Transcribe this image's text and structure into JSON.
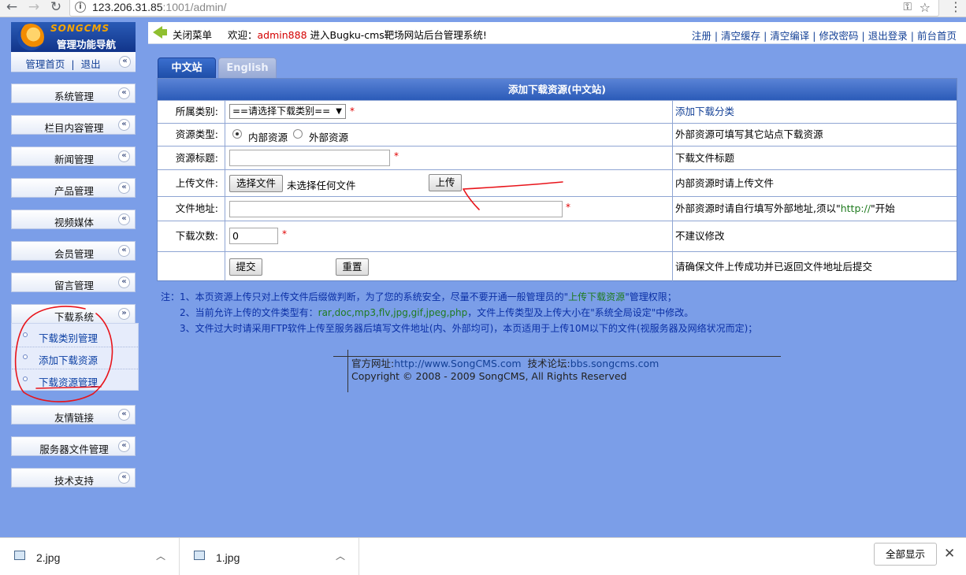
{
  "browser": {
    "url_host": "123.206.31.85",
    "url_path": ":1001/admin/"
  },
  "leftnav": {
    "brand": "SONGCMS",
    "title": "管理功能导航",
    "home": "管理首页",
    "sep": "|",
    "logout": "退出",
    "items": [
      {
        "label": "系统管理"
      },
      {
        "label": "栏目内容管理"
      },
      {
        "label": "新闻管理"
      },
      {
        "label": "产品管理"
      },
      {
        "label": "视频媒体"
      },
      {
        "label": "会员管理"
      },
      {
        "label": "留言管理"
      },
      {
        "label": "下载系统"
      },
      {
        "label": "友情链接"
      },
      {
        "label": "服务器文件管理"
      },
      {
        "label": "技术支持"
      }
    ],
    "submenu": [
      {
        "label": "下载类别管理"
      },
      {
        "label": "添加下载资源"
      },
      {
        "label": "下载资源管理"
      }
    ]
  },
  "topbar": {
    "close_menu": "关闭菜单",
    "welcome_prefix": "欢迎：",
    "username": "admin888",
    "welcome_suffix": "进入Bugku-cms靶场网站后台管理系统!",
    "links": [
      "注册",
      "清空缓存",
      "清空编译",
      "修改密码",
      "退出登录",
      "前台首页"
    ],
    "sep": "|"
  },
  "tabs": {
    "active": "中文站",
    "inactive": "English"
  },
  "form": {
    "title": "添加下载资源(中文站)",
    "req": "*",
    "category": {
      "label": "所属类别:",
      "selected": "==请选择下载类别==",
      "add_link": "添加下载分类"
    },
    "source_type": {
      "label": "资源类型:",
      "internal": "内部资源",
      "external": "外部资源",
      "hint": "外部资源可填写其它站点下载资源"
    },
    "res_title": {
      "label": "资源标题:",
      "value": "",
      "hint": "下载文件标题"
    },
    "upload": {
      "label": "上传文件:",
      "choose_btn": "选择文件",
      "no_file": "未选择任何文件",
      "upload_btn": "上传",
      "hint": "内部资源时请上传文件"
    },
    "file_url": {
      "label": "文件地址:",
      "value": "",
      "hint_prefix": "外部资源时请自行填写外部地址,须以\"",
      "hint_highlight": "http://",
      "hint_suffix": "\"开始"
    },
    "downloads": {
      "label": "下载次数:",
      "value": "0",
      "hint": "不建议修改"
    },
    "actions": {
      "submit": "提交",
      "reset": "重置",
      "hint": "请确保文件上传成功并已返回文件地址后提交"
    }
  },
  "notes": {
    "line1_prefix": "注：1、本页资源上传只对上传文件后缀做判断，为了您的系统安全，尽量不要开通一般管理员的\"",
    "line1_highlight": "上传下载资源",
    "line1_suffix": "\"管理权限；",
    "line2_prefix": "2、当前允许上传的文件类型有：",
    "line2_highlight": "rar,doc,mp3,flv,jpg,gif,jpeg,php",
    "line2_suffix": "，文件上传类型及上传大小在\"系统全局设定\"中修改。",
    "line3": "3、文件过大时请采用FTP软件上传至服务器后填写文件地址(内、外部均可)，本页适用于上传10M以下的文件(视服务器及网络状况而定)；"
  },
  "footer": {
    "site_label": "官方网址:",
    "site_url": "http://www.SongCMS.com",
    "forum_label": "技术论坛:",
    "forum_url": "bbs.songcms.com",
    "copyright": "Copyright © 2008 - 2009 SongCMS, All Rights Reserved"
  },
  "downloads_bar": {
    "files": [
      "2.jpg",
      "1.jpg"
    ],
    "show_all": "全部显示"
  },
  "colors": {
    "page_bg": "#7b9ee8",
    "panel_header": "#2b5bb8",
    "link": "#134096",
    "required": "#e00000",
    "annotation": "#e8141a"
  }
}
